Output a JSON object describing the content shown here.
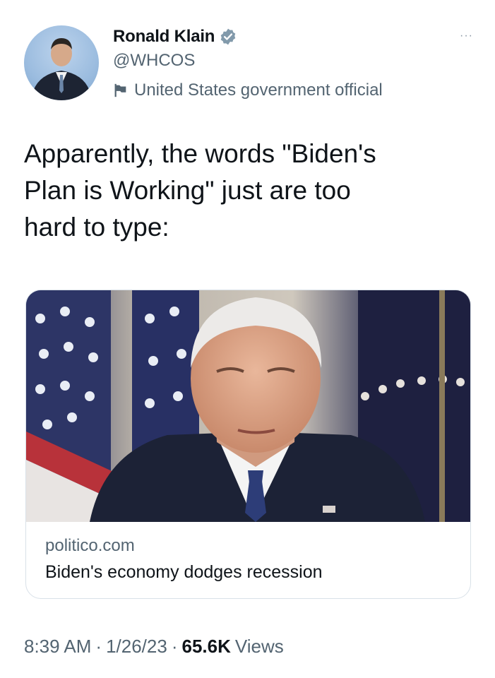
{
  "author": {
    "name": "Ronald Klain",
    "handle": "@WHCOS",
    "label": "United States government official",
    "verified_color": "#829aab"
  },
  "tweet": {
    "text": "Apparently, the words \"Biden's\nPlan is Working\" just are too\nhard to type:"
  },
  "card": {
    "domain": "politico.com",
    "title": "Biden's economy dodges recession"
  },
  "meta": {
    "time": "8:39 AM",
    "sep1": "·",
    "date": "1/26/23",
    "sep2": "·",
    "views_count": "65.6K",
    "views_label": "Views"
  },
  "icons": {
    "more": "···"
  }
}
